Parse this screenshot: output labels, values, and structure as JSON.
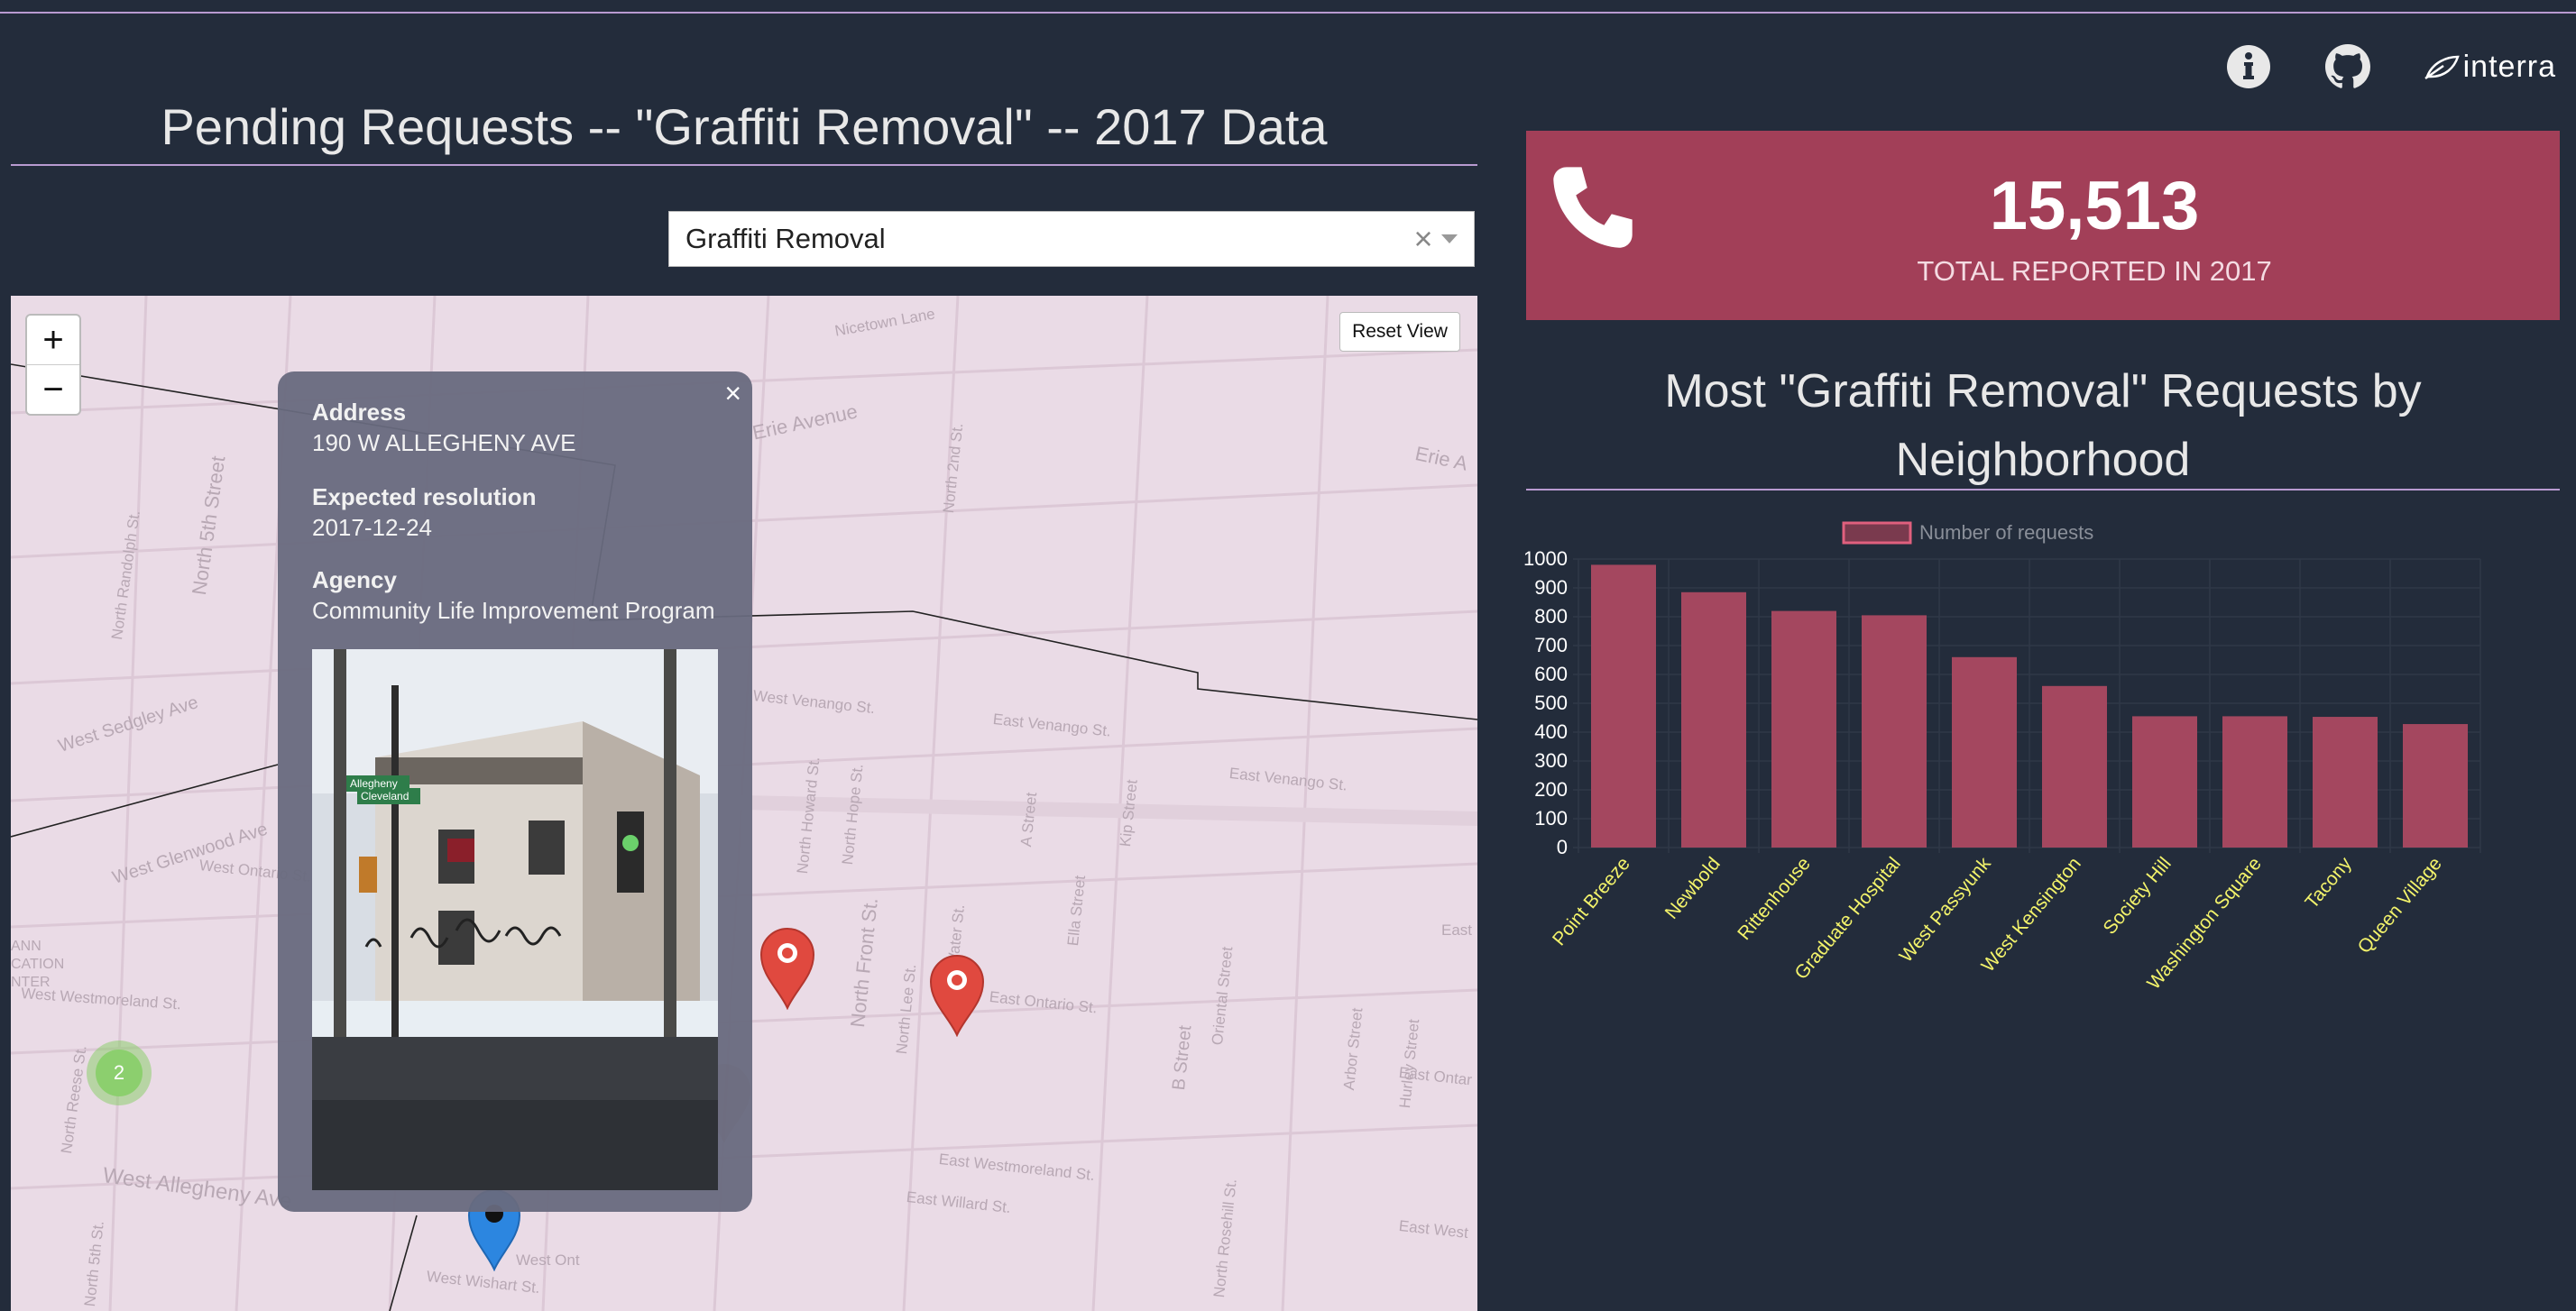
{
  "nav": {
    "info_icon": "info-icon",
    "github_icon": "github-icon",
    "brand_name": "interra"
  },
  "page": {
    "left_title": "Pending Requests -- \"Graffiti Removal\" -- 2017 Data"
  },
  "filter": {
    "selected": "Graffiti Removal",
    "clear_symbol": "×"
  },
  "map": {
    "zoom_in": "+",
    "zoom_out": "−",
    "reset_label": "Reset View",
    "cluster_count": "2",
    "streets": [
      "Nicetown Lane",
      "Erie Avenue",
      "Erie A",
      "North 5th Street",
      "North Randolph St.",
      "North Reese St.",
      "North Rosehill St.",
      "North 2nd St.",
      "North Front St.",
      "West Sedgley Ave",
      "West Glenwood Ave",
      "West Ontario St.",
      "West Venango St.",
      "East Venango St.",
      "East Venango St.",
      "East Ontario St.",
      "West Westmoreland St.",
      "West Allegheny Ave",
      "East Westmoreland St.",
      "East Willard St.",
      "West Wishart St.",
      "North Howard St.",
      "North Hope St.",
      "North Lee St.",
      "North Water St.",
      "A Street",
      "Ella Street",
      "Kip Street",
      "B Street",
      "Oriental Street",
      "Arbor Street",
      "Hurley Street",
      "East Ontar",
      "East West",
      "East",
      "West Ont",
      "North 5th St.",
      "ANN\nCATION\nNTER"
    ]
  },
  "popup": {
    "close": "×",
    "address_label": "Address",
    "address_value": "190 W ALLEGHENY AVE",
    "resolution_label": "Expected resolution",
    "resolution_value": "2017-12-24",
    "agency_label": "Agency",
    "agency_value": "Community Life Improvement Program",
    "sign_top": "Allegheny",
    "sign_bottom": "Cleveland"
  },
  "kpi": {
    "value": "15,513",
    "caption": "TOTAL REPORTED IN 2017",
    "icon": "phone-icon",
    "color": "#a23f58"
  },
  "right": {
    "chart_title_line1": "Most \"Graffiti Removal\" Requests by",
    "chart_title_line2": "Neighborhood"
  },
  "chart_data": {
    "type": "bar",
    "categories": [
      "Point Breeze",
      "Newbold",
      "Rittenhouse",
      "Graduate Hospital",
      "West Passyunk",
      "West Kensington",
      "Society Hill",
      "Washington Square",
      "Tacony",
      "Queen Village"
    ],
    "series": [
      {
        "name": "Number of requests",
        "values": [
          980,
          885,
          820,
          805,
          660,
          560,
          455,
          455,
          453,
          428
        ]
      }
    ],
    "ylim": [
      0,
      1000
    ],
    "yticks": [
      0,
      100,
      200,
      300,
      400,
      500,
      600,
      700,
      800,
      900,
      1000
    ],
    "legend": "top",
    "grid": true,
    "bar_color": "#a4475f",
    "label_color": "#f3f36b"
  }
}
